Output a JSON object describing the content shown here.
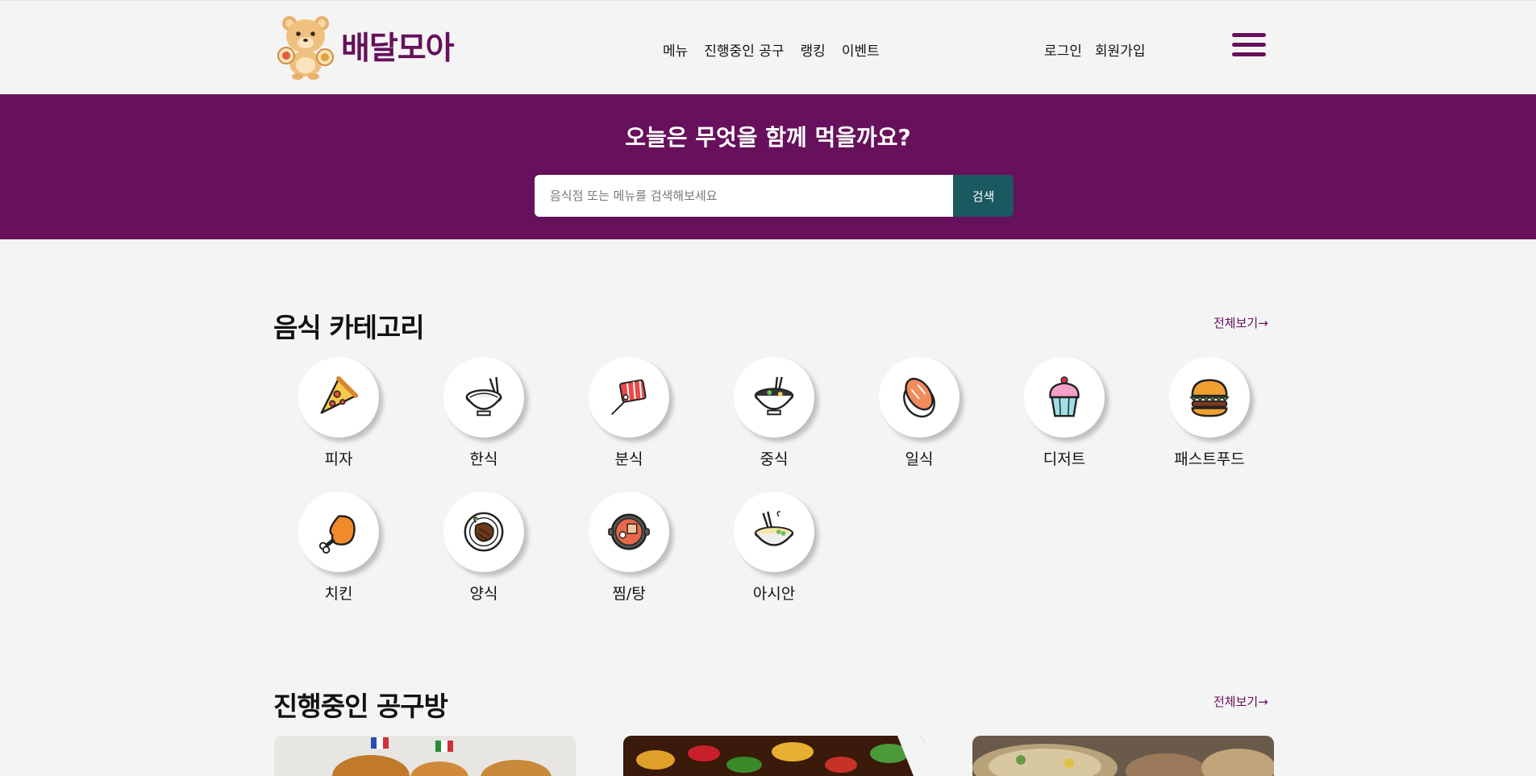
{
  "brand": {
    "name": "배달모아",
    "color": "#67105b"
  },
  "nav": [
    "메뉴",
    "진행중인 공구",
    "랭킹",
    "이벤트"
  ],
  "auth": {
    "login": "로그인",
    "signup": "회원가입"
  },
  "hero": {
    "title": "오늘은 무엇을 함께 먹을까요?",
    "placeholder": "음식점 또는 메뉴를 검색해보세요",
    "button": "검색"
  },
  "categories": {
    "title": "음식 카테고리",
    "see_all": "전체보기→",
    "items": [
      {
        "label": "피자",
        "icon": "pizza-icon"
      },
      {
        "label": "한식",
        "icon": "rice-bowl-icon"
      },
      {
        "label": "분식",
        "icon": "tteokbokki-icon"
      },
      {
        "label": "중식",
        "icon": "noodle-bowl-icon"
      },
      {
        "label": "일식",
        "icon": "sushi-icon"
      },
      {
        "label": "디저트",
        "icon": "cupcake-icon"
      },
      {
        "label": "패스트푸드",
        "icon": "burger-icon"
      },
      {
        "label": "치킨",
        "icon": "chicken-leg-icon"
      },
      {
        "label": "양식",
        "icon": "steak-icon"
      },
      {
        "label": "찜/탕",
        "icon": "stew-pot-icon"
      },
      {
        "label": "아시안",
        "icon": "asian-noodle-icon"
      }
    ]
  },
  "group_buys": {
    "title": "진행중인 공구방",
    "see_all": "전체보기→",
    "cards": [
      {
        "image": "bread-photo"
      },
      {
        "image": "stir-fry-photo"
      },
      {
        "image": "platter-photo"
      }
    ]
  }
}
